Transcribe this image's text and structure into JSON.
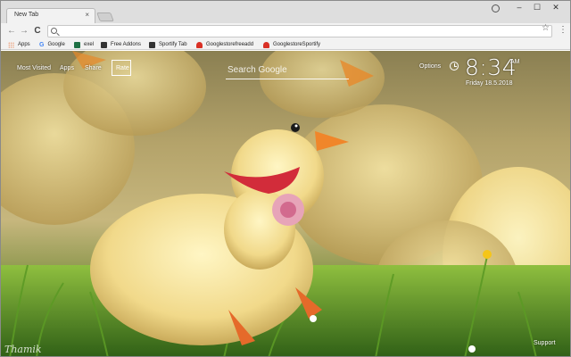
{
  "browser": {
    "tab": {
      "title": "New Tab",
      "close": "×"
    },
    "window": {
      "minimize": "–",
      "maximize": "☐",
      "close": "✕"
    },
    "nav": {
      "back": "←",
      "forward": "→",
      "reload": "C"
    },
    "omnibox": {
      "value": "",
      "placeholder": ""
    },
    "star": "☆",
    "menu": "⋮"
  },
  "bookmarks": [
    {
      "label": "Apps",
      "icon": "apps-grid-icon",
      "color": "#e8743b"
    },
    {
      "label": "Google",
      "icon": "google-icon",
      "color": "#4285f4"
    },
    {
      "label": "exel",
      "icon": "excel-icon",
      "color": "#1e7145"
    },
    {
      "label": "Free Addons",
      "icon": "addons-icon",
      "color": "#333333"
    },
    {
      "label": "Sportify Tab",
      "icon": "sportify-icon",
      "color": "#333333"
    },
    {
      "label": "Googlestorefreeadd",
      "icon": "store-icon",
      "color": "#d93025"
    },
    {
      "label": "GooglestoreSportify",
      "icon": "store-icon",
      "color": "#d93025"
    }
  ],
  "newtab": {
    "links": {
      "most_visited": "Most Visited",
      "apps": "Apps",
      "share": "Share",
      "rate": "Rate"
    },
    "search": {
      "placeholder": "Search Google"
    },
    "options": "Options",
    "clock": {
      "time": "8:34",
      "ampm": "AM",
      "date": "Friday  18.5.2018"
    },
    "support": "Support",
    "signature": "Thamik"
  },
  "colors": {
    "overlay_text": "#ffffff",
    "chrome_bg": "#f2f2f2",
    "tabstrip_bg": "#dedede"
  }
}
